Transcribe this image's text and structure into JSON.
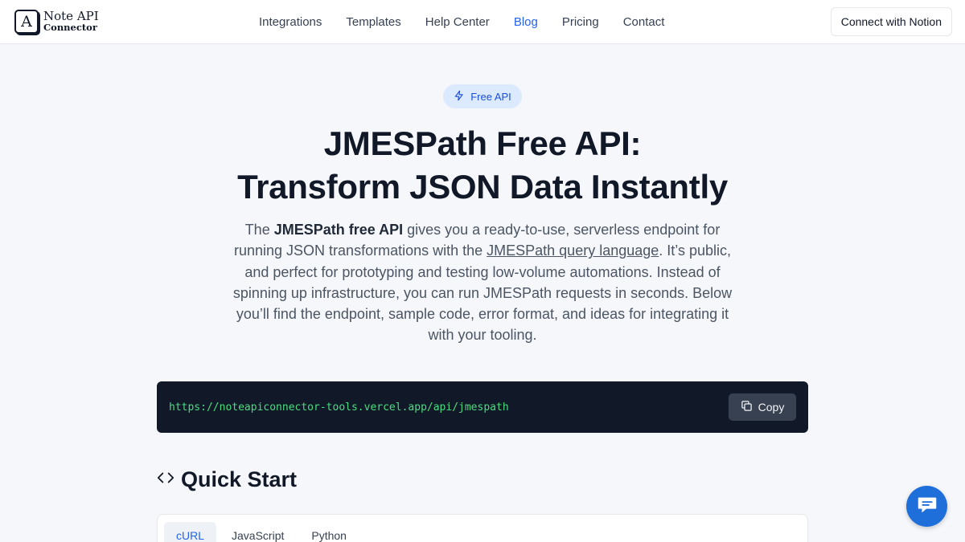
{
  "brand": {
    "line1": "Note API",
    "line2": "Connector",
    "mark": "A"
  },
  "nav": {
    "items": [
      {
        "label": "Integrations"
      },
      {
        "label": "Templates"
      },
      {
        "label": "Help Center"
      },
      {
        "label": "Blog",
        "active": true
      },
      {
        "label": "Pricing"
      },
      {
        "label": "Contact"
      }
    ],
    "cta": "Connect with Notion"
  },
  "hero": {
    "badge": "Free API",
    "badge_icon": "bolt-icon",
    "title_line1": "JMESPath Free API:",
    "title_line2": "Transform JSON Data Instantly",
    "intro": {
      "prefix": "The ",
      "bold": "JMESPath free API",
      "mid": " gives you a ready-to-use, serverless endpoint for running JSON transformations with the ",
      "link": "JMESPath query language",
      "suffix": ". It’s public, and perfect for prototyping and testing low-volume automations. Instead of spinning up infrastructure, you can run JMESPath requests in seconds. Below you’ll find the endpoint, sample code, error format, and ideas for integrating it with your tooling."
    }
  },
  "endpoint": {
    "url": "https://noteapiconnector-tools.vercel.app/api/jmespath",
    "copy_label": "Copy",
    "copy_icon": "copy-icon"
  },
  "quick_start": {
    "title": "Quick Start",
    "icon": "code-brackets-icon",
    "tabs": [
      {
        "label": "cURL",
        "active": true
      },
      {
        "label": "JavaScript"
      },
      {
        "label": "Python"
      }
    ]
  },
  "chat": {
    "icon": "chat-bubble-icon"
  },
  "colors": {
    "accent": "#2563eb",
    "badge_bg": "#dbeafe",
    "code_bg": "#111827",
    "code_text": "#4ade80",
    "chat_bg": "#1e6fd9"
  }
}
